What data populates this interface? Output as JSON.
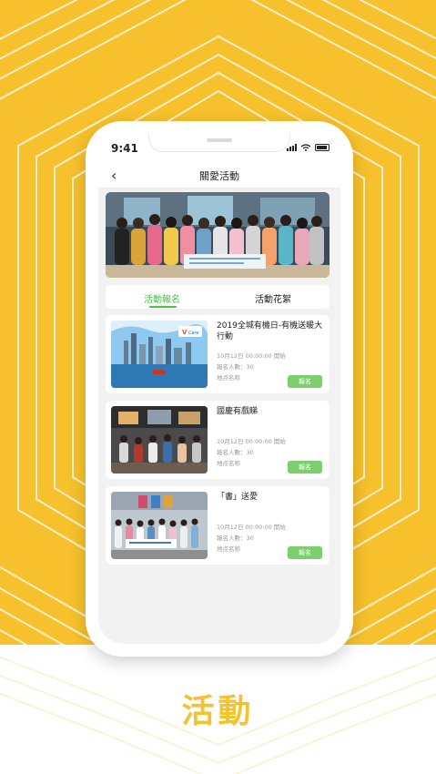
{
  "status_bar": {
    "time": "9:41"
  },
  "nav": {
    "back_glyph": "‹",
    "title": "關愛活動"
  },
  "tabs": [
    {
      "label": "活動報名",
      "active": true
    },
    {
      "label": "活動花絮",
      "active": false
    }
  ],
  "cards": [
    {
      "title": "2019全城有機日-有機送暖大行動",
      "date": "10月12日 00:00:00 開始",
      "participants": "報名人數：30",
      "location": "地点名称",
      "button": "報名"
    },
    {
      "title": "國慶有戲睇",
      "date": "10月12日 00:00:00 開始",
      "participants": "報名人數：30",
      "location": "地点名称",
      "button": "報名"
    },
    {
      "title": "「書」送愛",
      "date": "10月12日 00:00:00 開始",
      "participants": "報名人數：30",
      "location": "地点名称",
      "button": "報名"
    }
  ],
  "footer": {
    "label": "活動"
  },
  "colors": {
    "brand_yellow": "#f6c12c",
    "accent_green": "#4fbf4f",
    "button_green": "#7dcf6d"
  }
}
